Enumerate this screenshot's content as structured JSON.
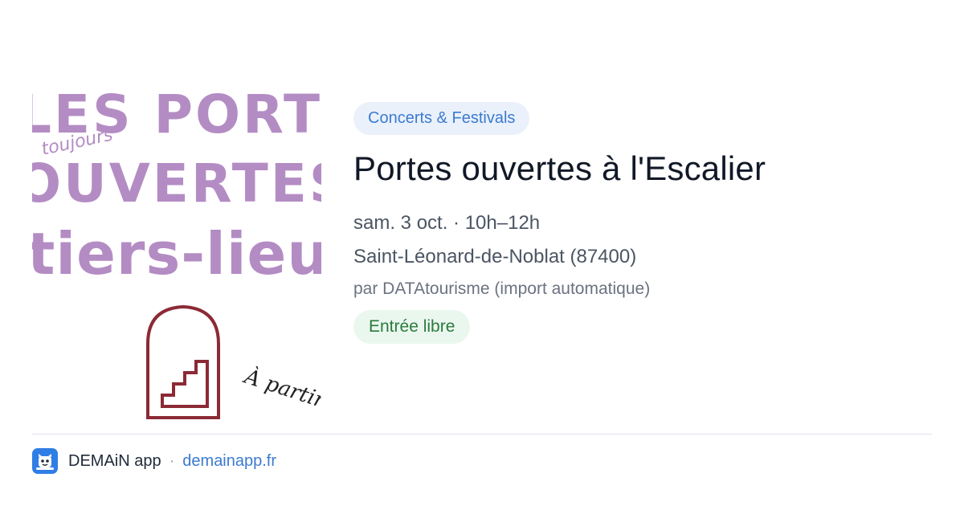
{
  "poster": {
    "line1": "LES PORTES",
    "line2": "toujours",
    "line3": "OUVERTES",
    "line4": "tiers-lieux",
    "script_text": "À partir"
  },
  "event": {
    "category": "Concerts & Festivals",
    "title": "Portes ouvertes à l'Escalier",
    "date_time": "sam. 3 oct. · 10h–12h",
    "location": "Saint-Léonard-de-Noblat (87400)",
    "source": "par DATAtourisme (import automatique)",
    "price": "Entrée libre"
  },
  "footer": {
    "app_name": "DEMAiN app",
    "separator": "·",
    "link": "demainapp.fr"
  },
  "colors": {
    "accent": "#3b7bd0",
    "category_bg": "#eaf1fb",
    "price_bg": "#eaf7ee",
    "price_text": "#2b7a3d",
    "poster_text": "#b48cc4",
    "arch": "#8b2a35",
    "app_icon": "#2f7ee6"
  },
  "icons": {
    "app": "demain-app-icon"
  }
}
